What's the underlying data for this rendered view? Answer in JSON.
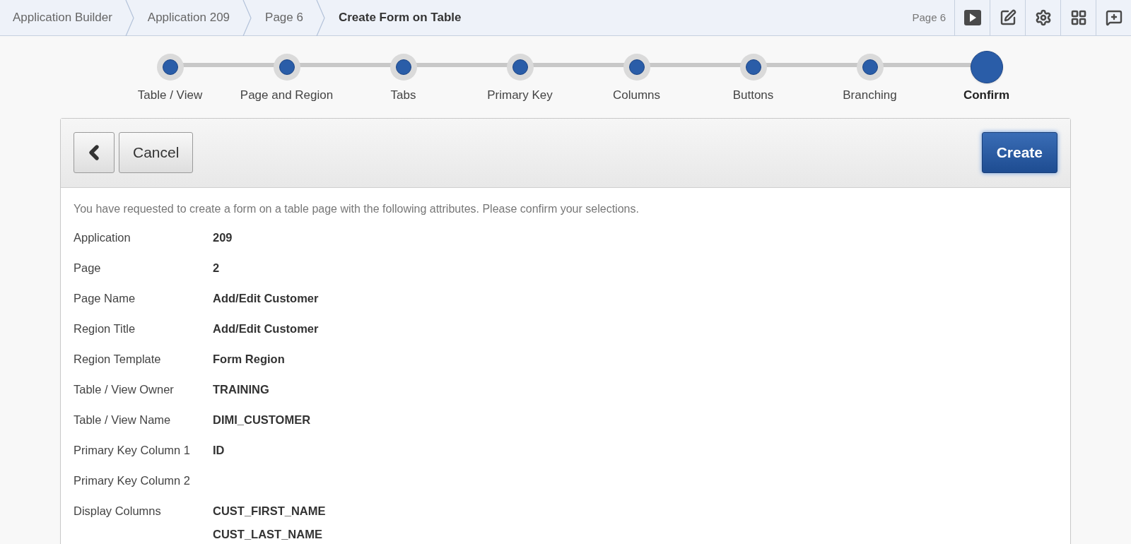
{
  "breadcrumbs": [
    {
      "label": "Application Builder",
      "current": false
    },
    {
      "label": "Application 209",
      "current": false
    },
    {
      "label": "Page 6",
      "current": false
    },
    {
      "label": "Create Form on Table",
      "current": true
    }
  ],
  "page_indicator": "Page 6",
  "wizard_steps": [
    {
      "label": "Table / View",
      "selected": false
    },
    {
      "label": "Page and Region",
      "selected": false
    },
    {
      "label": "Tabs",
      "selected": false
    },
    {
      "label": "Primary Key",
      "selected": false
    },
    {
      "label": "Columns",
      "selected": false
    },
    {
      "label": "Buttons",
      "selected": false
    },
    {
      "label": "Branching",
      "selected": false
    },
    {
      "label": "Confirm",
      "selected": true
    }
  ],
  "toolbar": {
    "cancel": "Cancel",
    "create": "Create"
  },
  "intro": "You have requested to create a form on a table page with the following attributes. Please confirm your selections.",
  "attributes": [
    {
      "label": "Application",
      "values": [
        "209"
      ]
    },
    {
      "label": "Page",
      "values": [
        "2"
      ]
    },
    {
      "label": "Page Name",
      "values": [
        "Add/Edit Customer"
      ]
    },
    {
      "label": "Region Title",
      "values": [
        "Add/Edit Customer"
      ]
    },
    {
      "label": "Region Template",
      "values": [
        "Form Region"
      ]
    },
    {
      "label": "Table / View Owner",
      "values": [
        "TRAINING"
      ]
    },
    {
      "label": "Table / View Name",
      "values": [
        "DIMI_CUSTOMER"
      ]
    },
    {
      "label": "Primary Key Column 1",
      "values": [
        "ID"
      ]
    },
    {
      "label": "Primary Key Column 2"
    },
    {
      "label": "Display Columns",
      "values": [
        "CUST_FIRST_NAME",
        "CUST_LAST_NAME"
      ]
    }
  ]
}
